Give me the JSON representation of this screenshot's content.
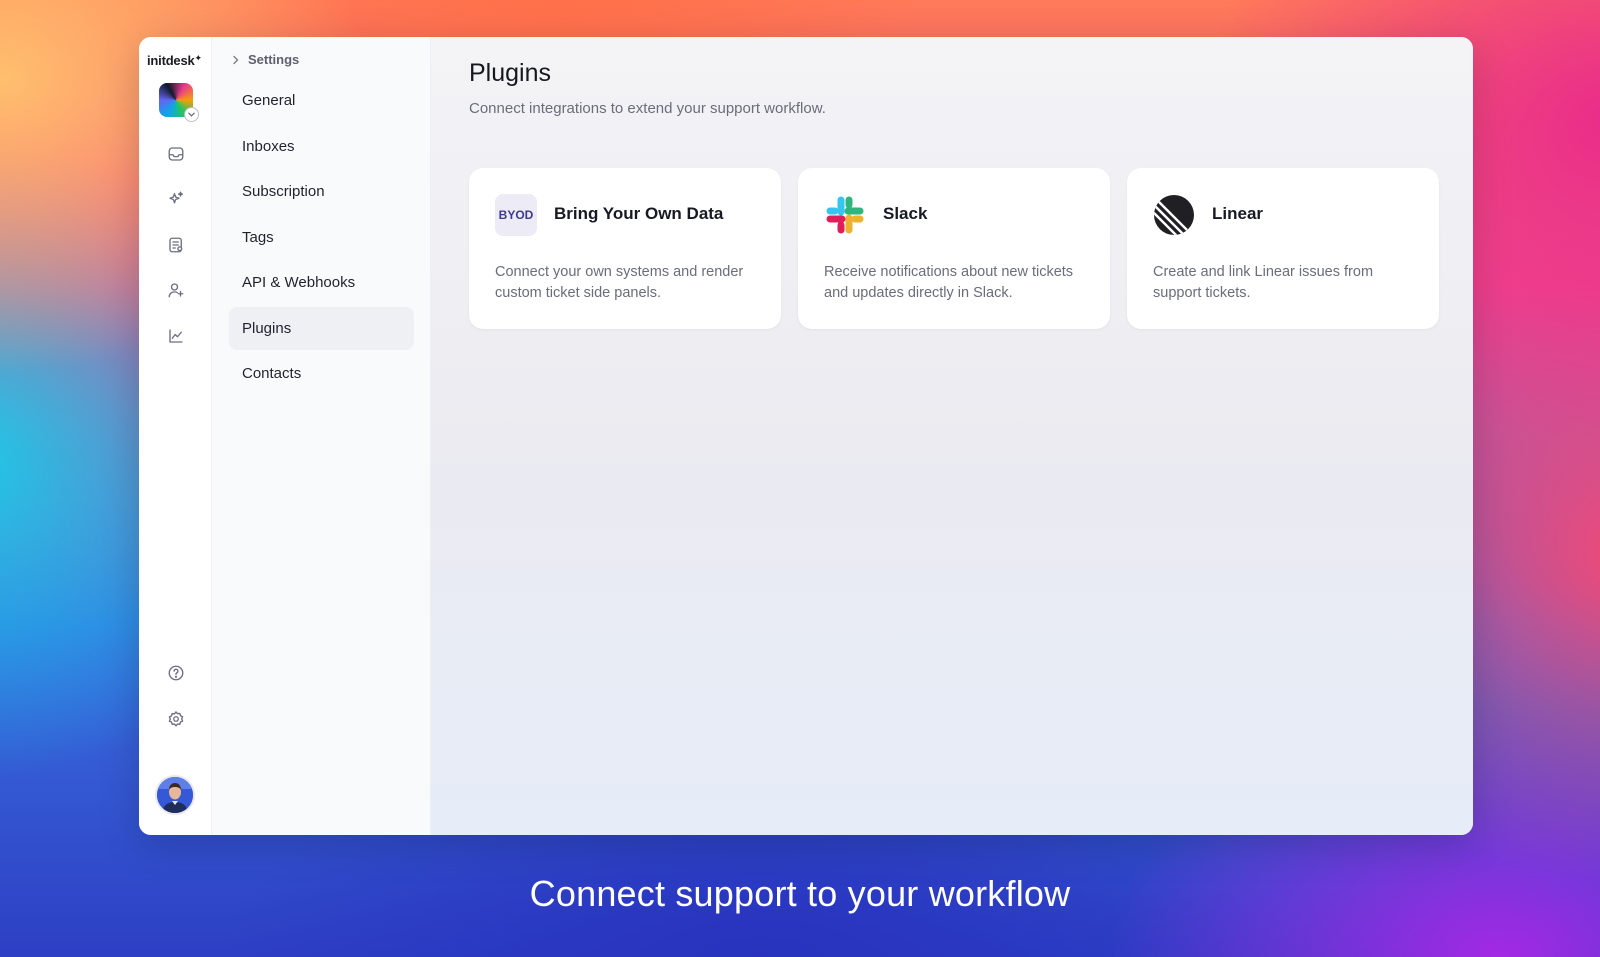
{
  "rail": {
    "brand": "initdesk",
    "brand_mark": "✦",
    "icons": [
      "inbox-icon",
      "sparkles-icon",
      "notes-icon",
      "user-add-icon",
      "chart-icon",
      "help-icon",
      "gear-icon"
    ]
  },
  "subnav": {
    "breadcrumb": "Settings",
    "items": [
      {
        "label": "General",
        "active": false
      },
      {
        "label": "Inboxes",
        "active": false
      },
      {
        "label": "Subscription",
        "active": false
      },
      {
        "label": "Tags",
        "active": false
      },
      {
        "label": "API & Webhooks",
        "active": false
      },
      {
        "label": "Plugins",
        "active": true
      },
      {
        "label": "Contacts",
        "active": false
      }
    ]
  },
  "main": {
    "title": "Plugins",
    "subtitle": "Connect integrations to extend your support workflow.",
    "cards": [
      {
        "logo_text": "BYOD",
        "title": "Bring Your Own Data",
        "description": "Connect your own systems and render custom ticket side panels."
      },
      {
        "title": "Slack",
        "description": "Receive notifications about new tickets and updates directly in Slack."
      },
      {
        "title": "Linear",
        "description": "Create and link Linear issues from support tickets."
      }
    ]
  },
  "tagline": "Connect support to your workflow",
  "colors": {
    "active_nav_bg": "#eff0f4",
    "slack_blue": "#36C5F0",
    "slack_green": "#2EB67D",
    "slack_yellow": "#ECB22E",
    "slack_red": "#E01E5A",
    "linear_dark": "#1f1f24"
  }
}
